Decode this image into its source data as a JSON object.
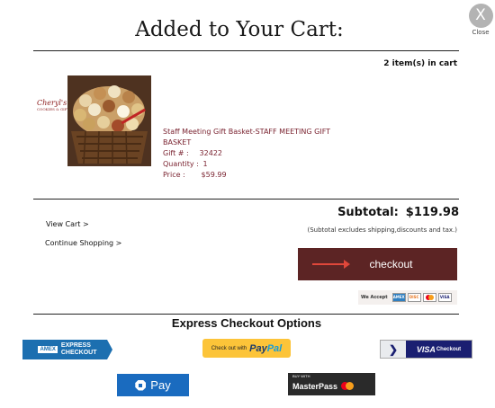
{
  "close": {
    "icon": "close-x-icon",
    "glyph": "X",
    "label": "Close"
  },
  "title": "Added to Your Cart:",
  "cart": {
    "item_count": "2 item(s) in cart"
  },
  "brand": {
    "logo_text": "Cheryl's",
    "logo_sub": "COOKIES & GIFTS"
  },
  "product": {
    "name": "Staff Meeting Gift Basket-STAFF MEETING GIFT BASKET",
    "gift_label": "Gift # :",
    "gift_value": "32422",
    "qty_label": "Quantity :",
    "qty_value": "1",
    "price_label": "Price :",
    "price_value": "$59.99"
  },
  "links": {
    "view_cart": "View Cart >",
    "continue_shopping": "Continue Shopping >"
  },
  "summary": {
    "subtotal_label": "Subtotal:",
    "subtotal_value": "$119.98",
    "note": "(Subtotal excludes shipping,discounts and tax.)"
  },
  "checkout": {
    "label": "checkout",
    "accent": "#5c2424"
  },
  "accepted": {
    "label": "We Accept",
    "cards": [
      "AMEX",
      "DISC",
      "MC",
      "VISA"
    ]
  },
  "express": {
    "title": "Express Checkout Options",
    "amex_box": "AMEX",
    "amex_line1": "EXPRESS",
    "amex_line2": "CHECKOUT",
    "paypal_prefix": "Check out with",
    "paypal_p1": "Pay",
    "paypal_p2": "Pal",
    "visa_label": "VISA",
    "visa_sub": "Checkout",
    "chase_label": "Pay",
    "mp_buy": "BUY WITH",
    "mp_name": "MasterPass"
  }
}
